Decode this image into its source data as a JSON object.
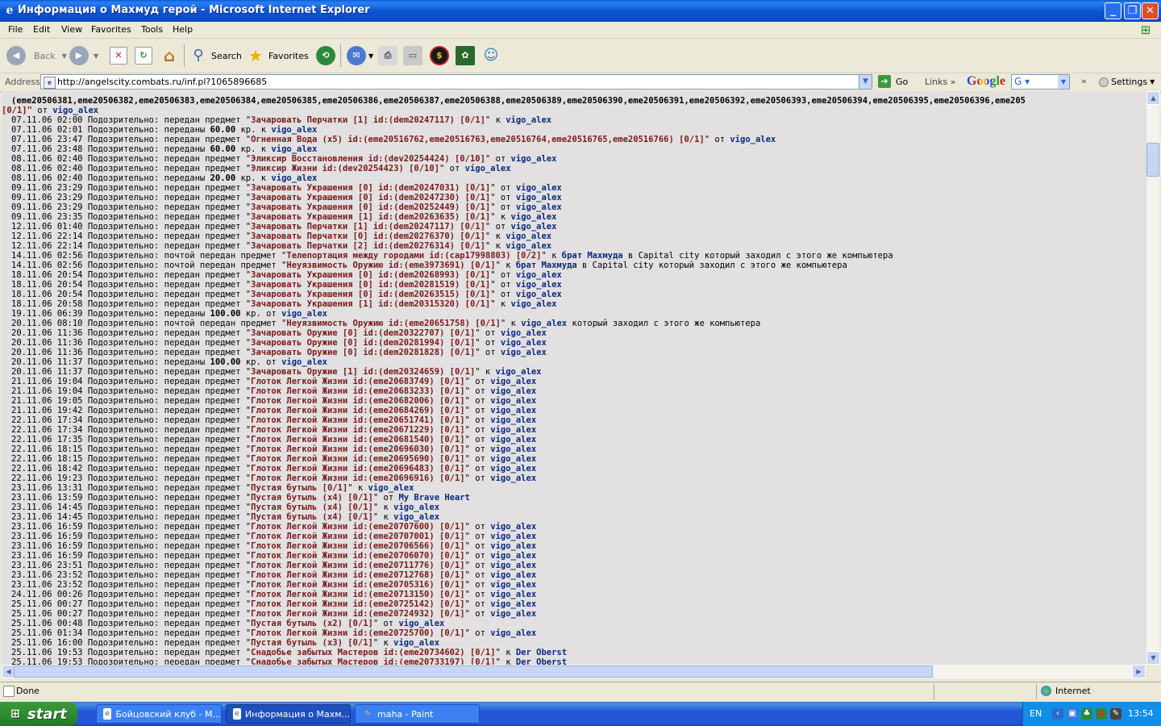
{
  "window": {
    "title": "Информация о Махмуд герой - Microsoft Internet Explorer",
    "minimize": "_",
    "maximize": "❐",
    "close": "✕"
  },
  "menu": [
    "File",
    "Edit",
    "View",
    "Favorites",
    "Tools",
    "Help"
  ],
  "toolbar": {
    "back": "Back",
    "search": "Search",
    "favorites": "Favorites"
  },
  "address": {
    "label": "Address",
    "url": "http://angelscity.combats.ru/inf.pl?1065896685",
    "go": "Go",
    "links": "Links",
    "google": "Google",
    "google_select": "G",
    "settings": "Settings"
  },
  "log": {
    "continuation1": "(eme20506381,eme20506382,eme20506383,eme20506384,eme20506385,eme20506386,eme20506387,eme20506388,eme20506389,eme20506390,eme20506391,eme20506392,eme20506393,eme20506394,eme20506395,eme20506396,eme205",
    "continuation2_item": "[0/1]\"",
    "continuation2_dir": " от ",
    "continuation2_user": "vigo_alex",
    "lines": [
      {
        "t": "07.11.06 02:00 Подозрительно: передан предмет \"",
        "item": "Зачаровать Перчатки [1] id:(dem20247117) [0/1]",
        "dir": "\" к ",
        "user": "vigo_alex",
        "tail": ""
      },
      {
        "t": "07.11.06 02:01 Подозрительно: переданы ",
        "item": "60.00",
        "dir": " кр. к ",
        "user": "vigo_alex",
        "tail": ""
      },
      {
        "t": "07.11.06 23:47 Подозрительно: передан предмет \"",
        "item": "Огненная Вода (x5) id:(eme20516762,eme20516763,eme20516764,eme20516765,eme20516766) [0/1]",
        "dir": "\" от ",
        "user": "vigo_alex",
        "tail": ""
      },
      {
        "t": "07.11.06 23:48 Подозрительно: переданы ",
        "item": "60.00",
        "dir": " кр. к ",
        "user": "vigo_alex",
        "tail": ""
      },
      {
        "t": "08.11.06 02:40 Подозрительно: передан предмет \"",
        "item": "Эликсир Восстановления id:(dev20254424) [0/10]",
        "dir": "\" от ",
        "user": "vigo_alex",
        "tail": ""
      },
      {
        "t": "08.11.06 02:40 Подозрительно: передан предмет \"",
        "item": "Эликсир Жизни id:(dev20254423) [0/10]",
        "dir": "\" от ",
        "user": "vigo_alex",
        "tail": ""
      },
      {
        "t": "08.11.06 02:40 Подозрительно: переданы ",
        "item": "20.00",
        "dir": " кр. к ",
        "user": "vigo_alex",
        "tail": ""
      },
      {
        "t": "09.11.06 23:29 Подозрительно: передан предмет \"",
        "item": "Зачаровать Украшения [0] id:(dem20247031) [0/1]",
        "dir": "\" от ",
        "user": "vigo_alex",
        "tail": ""
      },
      {
        "t": "09.11.06 23:29 Подозрительно: передан предмет \"",
        "item": "Зачаровать Украшения [0] id:(dem20247230) [0/1]",
        "dir": "\" от ",
        "user": "vigo_alex",
        "tail": ""
      },
      {
        "t": "09.11.06 23:29 Подозрительно: передан предмет \"",
        "item": "Зачаровать Украшения [0] id:(dem20252449) [0/1]",
        "dir": "\" от ",
        "user": "vigo_alex",
        "tail": ""
      },
      {
        "t": "09.11.06 23:35 Подозрительно: передан предмет \"",
        "item": "Зачаровать Украшения [1] id:(dem20263635) [0/1]",
        "dir": "\" к ",
        "user": "vigo_alex",
        "tail": ""
      },
      {
        "t": "12.11.06 01:40 Подозрительно: передан предмет \"",
        "item": "Зачаровать Перчатки [1] id:(dem20247117) [0/1]",
        "dir": "\" от ",
        "user": "vigo_alex",
        "tail": ""
      },
      {
        "t": "12.11.06 22:14 Подозрительно: передан предмет \"",
        "item": "Зачаровать Перчатки [0] id:(dem20276370) [0/1]",
        "dir": "\" к ",
        "user": "vigo_alex",
        "tail": ""
      },
      {
        "t": "12.11.06 22:14 Подозрительно: передан предмет \"",
        "item": "Зачаровать Перчатки [2] id:(dem20276314) [0/1]",
        "dir": "\" к ",
        "user": "vigo_alex",
        "tail": ""
      },
      {
        "t": "14.11.06 02:56 Подозрительно: почтой передан предмет \"",
        "item": "Телепортация между городами id:(cap17998803) [0/2]",
        "dir": "\" к ",
        "user": "брат Махмуда",
        "tail": " в Capital city который заходил с этого же компьютера"
      },
      {
        "t": "14.11.06 02:56 Подозрительно: почтой передан предмет \"",
        "item": "Неуязвимость Оружию id:(eme3973691) [0/1]",
        "dir": "\" к ",
        "user": "брат Махмуда",
        "tail": " в Capital city который заходил с этого же компьютера"
      },
      {
        "t": "18.11.06 20:54 Подозрительно: передан предмет \"",
        "item": "Зачаровать Украшения [0] id:(dem20268993) [0/1]",
        "dir": "\" от ",
        "user": "vigo_alex",
        "tail": ""
      },
      {
        "t": "18.11.06 20:54 Подозрительно: передан предмет \"",
        "item": "Зачаровать Украшения [0] id:(dem20281519) [0/1]",
        "dir": "\" от ",
        "user": "vigo_alex",
        "tail": ""
      },
      {
        "t": "18.11.06 20:54 Подозрительно: передан предмет \"",
        "item": "Зачаровать Украшения [0] id:(dem20263515) [0/1]",
        "dir": "\" от ",
        "user": "vigo_alex",
        "tail": ""
      },
      {
        "t": "18.11.06 20:58 Подозрительно: передан предмет \"",
        "item": "Зачаровать Украшения [1] id:(dem20315320) [0/1]",
        "dir": "\" к ",
        "user": "vigo_alex",
        "tail": ""
      },
      {
        "t": "19.11.06 06:39 Подозрительно: переданы ",
        "item": "100.00",
        "dir": " кр. от ",
        "user": "vigo_alex",
        "tail": ""
      },
      {
        "t": "20.11.06 08:10 Подозрительно: почтой передан предмет \"",
        "item": "Неуязвимость Оружию id:(eme20651758) [0/1]",
        "dir": "\" к ",
        "user": "vigo_alex",
        "tail": " который заходил с этого же компьютера"
      },
      {
        "t": "20.11.06 11:36 Подозрительно: передан предмет \"",
        "item": "Зачаровать Оружие [0] id:(dem20322707) [0/1]",
        "dir": "\" от ",
        "user": "vigo_alex",
        "tail": ""
      },
      {
        "t": "20.11.06 11:36 Подозрительно: передан предмет \"",
        "item": "Зачаровать Оружие [0] id:(dem20281994) [0/1]",
        "dir": "\" от ",
        "user": "vigo_alex",
        "tail": ""
      },
      {
        "t": "20.11.06 11:36 Подозрительно: передан предмет \"",
        "item": "Зачаровать Оружие [0] id:(dem20281828) [0/1]",
        "dir": "\" от ",
        "user": "vigo_alex",
        "tail": ""
      },
      {
        "t": "20.11.06 11:37 Подозрительно: переданы ",
        "item": "100.00",
        "dir": " кр. от ",
        "user": "vigo_alex",
        "tail": ""
      },
      {
        "t": "20.11.06 11:37 Подозрительно: передан предмет \"",
        "item": "Зачаровать Оружие [1] id:(dem20324659) [0/1]",
        "dir": "\" к ",
        "user": "vigo_alex",
        "tail": ""
      },
      {
        "t": "21.11.06 19:04 Подозрительно: передан предмет \"",
        "item": "Глоток Легкой Жизни id:(eme20683749) [0/1]",
        "dir": "\" от ",
        "user": "vigo_alex",
        "tail": ""
      },
      {
        "t": "21.11.06 19:04 Подозрительно: передан предмет \"",
        "item": "Глоток Легкой Жизни id:(eme20683233) [0/1]",
        "dir": "\" от ",
        "user": "vigo_alex",
        "tail": ""
      },
      {
        "t": "21.11.06 19:05 Подозрительно: передан предмет \"",
        "item": "Глоток Легкой Жизни id:(eme20682006) [0/1]",
        "dir": "\" от ",
        "user": "vigo_alex",
        "tail": ""
      },
      {
        "t": "21.11.06 19:42 Подозрительно: передан предмет \"",
        "item": "Глоток Легкой Жизни id:(eme20684269) [0/1]",
        "dir": "\" от ",
        "user": "vigo_alex",
        "tail": ""
      },
      {
        "t": "22.11.06 17:34 Подозрительно: передан предмет \"",
        "item": "Глоток Легкой Жизни id:(eme20651741) [0/1]",
        "dir": "\" от ",
        "user": "vigo_alex",
        "tail": ""
      },
      {
        "t": "22.11.06 17:34 Подозрительно: передан предмет \"",
        "item": "Глоток Легкой Жизни id:(eme20671229) [0/1]",
        "dir": "\" от ",
        "user": "vigo_alex",
        "tail": ""
      },
      {
        "t": "22.11.06 17:35 Подозрительно: передан предмет \"",
        "item": "Глоток Легкой Жизни id:(eme20681540) [0/1]",
        "dir": "\" от ",
        "user": "vigo_alex",
        "tail": ""
      },
      {
        "t": "22.11.06 18:15 Подозрительно: передан предмет \"",
        "item": "Глоток Легкой Жизни id:(eme20696030) [0/1]",
        "dir": "\" от ",
        "user": "vigo_alex",
        "tail": ""
      },
      {
        "t": "22.11.06 18:15 Подозрительно: передан предмет \"",
        "item": "Глоток Легкой Жизни id:(eme20695690) [0/1]",
        "dir": "\" от ",
        "user": "vigo_alex",
        "tail": ""
      },
      {
        "t": "22.11.06 18:42 Подозрительно: передан предмет \"",
        "item": "Глоток Легкой Жизни id:(eme20696483) [0/1]",
        "dir": "\" от ",
        "user": "vigo_alex",
        "tail": ""
      },
      {
        "t": "22.11.06 19:23 Подозрительно: передан предмет \"",
        "item": "Глоток Легкой Жизни id:(eme20696916) [0/1]",
        "dir": "\" от ",
        "user": "vigo_alex",
        "tail": ""
      },
      {
        "t": "23.11.06 13:31 Подозрительно: передан предмет \"",
        "item": "Пустая бутыль [0/1]",
        "dir": "\" к ",
        "user": "vigo_alex",
        "tail": ""
      },
      {
        "t": "23.11.06 13:59 Подозрительно: передан предмет \"",
        "item": "Пустая бутыль (x4) [0/1]",
        "dir": "\" от ",
        "user": "My Brave Heart",
        "tail": ""
      },
      {
        "t": "23.11.06 14:45 Подозрительно: передан предмет \"",
        "item": "Пустая бутыль (x4) [0/1]",
        "dir": "\" к ",
        "user": "vigo_alex",
        "tail": ""
      },
      {
        "t": "23.11.06 14:45 Подозрительно: передан предмет \"",
        "item": "Пустая бутыль (x4) [0/1]",
        "dir": "\" к ",
        "user": "vigo_alex",
        "tail": ""
      },
      {
        "t": "23.11.06 16:59 Подозрительно: передан предмет \"",
        "item": "Глоток Легкой Жизни id:(eme20707600) [0/1]",
        "dir": "\" от ",
        "user": "vigo_alex",
        "tail": ""
      },
      {
        "t": "23.11.06 16:59 Подозрительно: передан предмет \"",
        "item": "Глоток Легкой Жизни id:(eme20707001) [0/1]",
        "dir": "\" от ",
        "user": "vigo_alex",
        "tail": ""
      },
      {
        "t": "23.11.06 16:59 Подозрительно: передан предмет \"",
        "item": "Глоток Легкой Жизни id:(eme20706566) [0/1]",
        "dir": "\" от ",
        "user": "vigo_alex",
        "tail": ""
      },
      {
        "t": "23.11.06 16:59 Подозрительно: передан предмет \"",
        "item": "Глоток Легкой Жизни id:(eme20706070) [0/1]",
        "dir": "\" от ",
        "user": "vigo_alex",
        "tail": ""
      },
      {
        "t": "23.11.06 23:51 Подозрительно: передан предмет \"",
        "item": "Глоток Легкой Жизни id:(eme20711776) [0/1]",
        "dir": "\" от ",
        "user": "vigo_alex",
        "tail": ""
      },
      {
        "t": "23.11.06 23:52 Подозрительно: передан предмет \"",
        "item": "Глоток Легкой Жизни id:(eme20712768) [0/1]",
        "dir": "\" от ",
        "user": "vigo_alex",
        "tail": ""
      },
      {
        "t": "23.11.06 23:52 Подозрительно: передан предмет \"",
        "item": "Глоток Легкой Жизни id:(eme20705316) [0/1]",
        "dir": "\" от ",
        "user": "vigo_alex",
        "tail": ""
      },
      {
        "t": "24.11.06 00:26 Подозрительно: передан предмет \"",
        "item": "Глоток Легкой Жизни id:(eme20713150) [0/1]",
        "dir": "\" от ",
        "user": "vigo_alex",
        "tail": ""
      },
      {
        "t": "25.11.06 00:27 Подозрительно: передан предмет \"",
        "item": "Глоток Легкой Жизни id:(eme20725142) [0/1]",
        "dir": "\" от ",
        "user": "vigo_alex",
        "tail": ""
      },
      {
        "t": "25.11.06 00:27 Подозрительно: передан предмет \"",
        "item": "Глоток Легкой Жизни id:(eme20724932) [0/1]",
        "dir": "\" от ",
        "user": "vigo_alex",
        "tail": ""
      },
      {
        "t": "25.11.06 00:48 Подозрительно: передан предмет \"",
        "item": "Пустая бутыль (x2) [0/1]",
        "dir": "\" от ",
        "user": "vigo_alex",
        "tail": ""
      },
      {
        "t": "25.11.06 01:34 Подозрительно: передан предмет \"",
        "item": "Глоток Легкой Жизни id:(eme20725700) [0/1]",
        "dir": "\" от ",
        "user": "vigo_alex",
        "tail": ""
      },
      {
        "t": "25.11.06 16:00 Подозрительно: передан предмет \"",
        "item": "Пустая бутыль (x3) [0/1]",
        "dir": "\" к ",
        "user": "vigo_alex",
        "tail": ""
      },
      {
        "t": "25.11.06 19:53 Подозрительно: передан предмет \"",
        "item": "Снадобье забытых Мастеров id:(eme20734602) [0/1]",
        "dir": "\" к ",
        "user": "Der Oberst",
        "tail": ""
      },
      {
        "t": "25.11.06 19:53 Подозрительно: передан предмет \"",
        "item": "Снадобье забытых Мастеров id:(eme20733197) [0/1]",
        "dir": "\" к ",
        "user": "Der Oberst",
        "tail": ""
      }
    ]
  },
  "status": {
    "text": "Done",
    "zone": "Internet"
  },
  "taskbar": {
    "start": "start",
    "tasks": [
      {
        "label": "Бойцовский клуб - M..."
      },
      {
        "label": "Информация о Махм..."
      },
      {
        "label": "maha - Paint"
      }
    ],
    "lang": "EN",
    "clock": "13:54"
  }
}
